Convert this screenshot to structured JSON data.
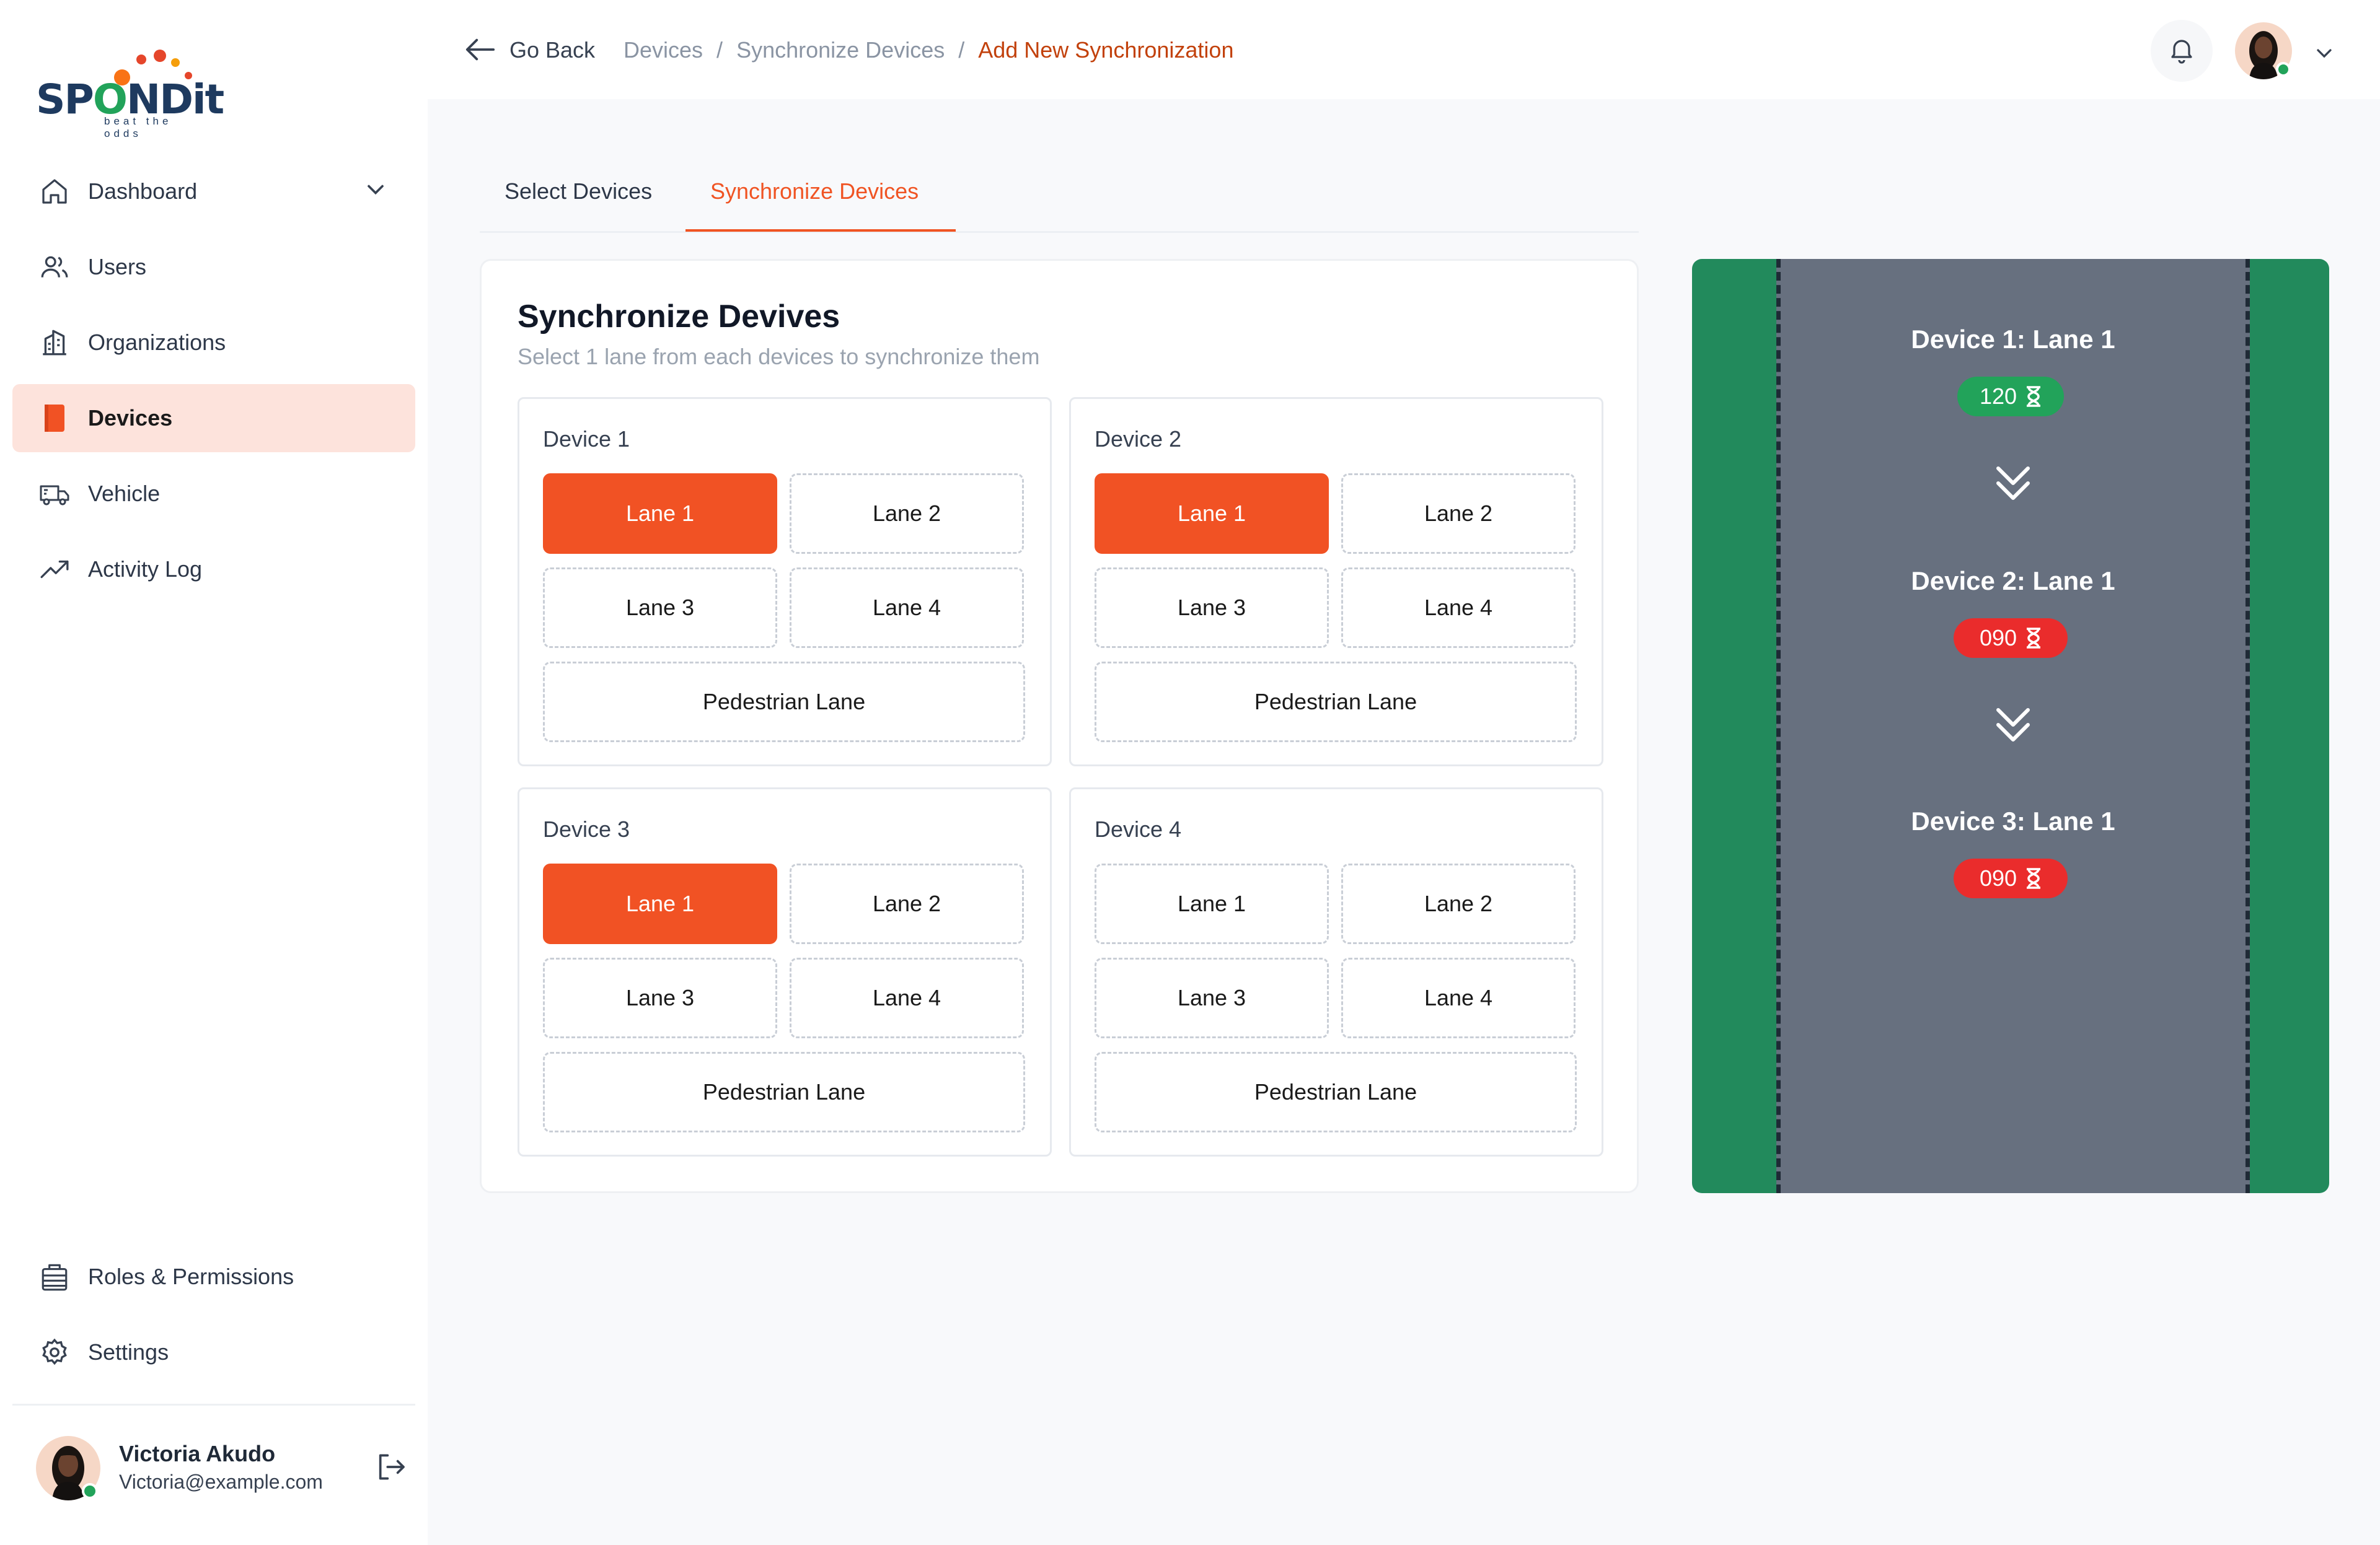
{
  "brand": {
    "name_part1": "SP",
    "name_o": "O",
    "name_part2": "NDit",
    "tagline": "beat the odds"
  },
  "sidebar": {
    "items": [
      {
        "label": "Dashboard",
        "icon": "home-icon",
        "has_chevron": true
      },
      {
        "label": "Users",
        "icon": "users-icon"
      },
      {
        "label": "Organizations",
        "icon": "building-icon"
      },
      {
        "label": "Devices",
        "icon": "device-icon",
        "active": true
      },
      {
        "label": "Vehicle",
        "icon": "truck-icon"
      },
      {
        "label": "Activity Log",
        "icon": "trend-icon"
      }
    ],
    "bottom_items": [
      {
        "label": "Roles & Permissions",
        "icon": "briefcase-icon"
      },
      {
        "label": "Settings",
        "icon": "gear-icon"
      }
    ],
    "user": {
      "name": "Victoria Akudo",
      "email": "Victoria@example.com"
    }
  },
  "header": {
    "go_back": "Go Back",
    "breadcrumb": [
      "Devices",
      "/",
      "Synchronize Devices",
      "/",
      "Add New Synchronization"
    ]
  },
  "tabs": [
    "Select Devices",
    "Synchronize Devices"
  ],
  "active_tab": "Synchronize Devices",
  "panel": {
    "title": "Synchronize Devives",
    "subtitle": "Select 1 lane from each devices to synchronize them"
  },
  "devices": [
    {
      "title": "Device 1",
      "lanes": [
        "Lane 1",
        "Lane 2",
        "Lane 3",
        "Lane 4"
      ],
      "pedestrian": "Pedestrian Lane",
      "selected": "Lane 1"
    },
    {
      "title": "Device 2",
      "lanes": [
        "Lane 1",
        "Lane 2",
        "Lane 3",
        "Lane 4"
      ],
      "pedestrian": "Pedestrian Lane",
      "selected": "Lane 1"
    },
    {
      "title": "Device 3",
      "lanes": [
        "Lane 1",
        "Lane 2",
        "Lane 3",
        "Lane 4"
      ],
      "pedestrian": "Pedestrian Lane",
      "selected": "Lane 1"
    },
    {
      "title": "Device 4",
      "lanes": [
        "Lane 1",
        "Lane 2",
        "Lane 3",
        "Lane 4"
      ],
      "pedestrian": "Pedestrian Lane",
      "selected": null
    }
  ],
  "sync_chain": [
    {
      "label": "Device 1: Lane 1",
      "timer": "120",
      "status": "green"
    },
    {
      "label": "Device 2: Lane 1",
      "timer": "090",
      "status": "red"
    },
    {
      "label": "Device 3: Lane 1",
      "timer": "090",
      "status": "red"
    }
  ],
  "colors": {
    "accent": "#f15224",
    "active_nav_bg": "#fde3dc",
    "road_green": "#228a5c",
    "asphalt": "#67707f",
    "timer_green": "#22a35a",
    "timer_red": "#ea2c2c"
  }
}
